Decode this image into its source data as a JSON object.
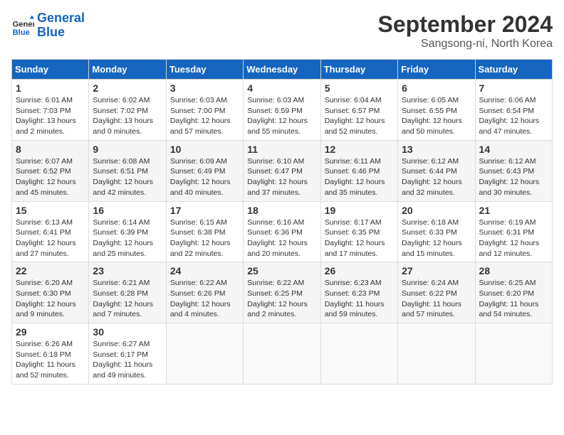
{
  "header": {
    "logo_line1": "General",
    "logo_line2": "Blue",
    "month": "September 2024",
    "location": "Sangsong-ni, North Korea"
  },
  "days_of_week": [
    "Sunday",
    "Monday",
    "Tuesday",
    "Wednesday",
    "Thursday",
    "Friday",
    "Saturday"
  ],
  "weeks": [
    [
      {
        "day": "1",
        "sunrise": "6:01 AM",
        "sunset": "7:03 PM",
        "daylight": "13 hours and 2 minutes."
      },
      {
        "day": "2",
        "sunrise": "6:02 AM",
        "sunset": "7:02 PM",
        "daylight": "13 hours and 0 minutes."
      },
      {
        "day": "3",
        "sunrise": "6:03 AM",
        "sunset": "7:00 PM",
        "daylight": "12 hours and 57 minutes."
      },
      {
        "day": "4",
        "sunrise": "6:03 AM",
        "sunset": "6:59 PM",
        "daylight": "12 hours and 55 minutes."
      },
      {
        "day": "5",
        "sunrise": "6:04 AM",
        "sunset": "6:57 PM",
        "daylight": "12 hours and 52 minutes."
      },
      {
        "day": "6",
        "sunrise": "6:05 AM",
        "sunset": "6:55 PM",
        "daylight": "12 hours and 50 minutes."
      },
      {
        "day": "7",
        "sunrise": "6:06 AM",
        "sunset": "6:54 PM",
        "daylight": "12 hours and 47 minutes."
      }
    ],
    [
      {
        "day": "8",
        "sunrise": "6:07 AM",
        "sunset": "6:52 PM",
        "daylight": "12 hours and 45 minutes."
      },
      {
        "day": "9",
        "sunrise": "6:08 AM",
        "sunset": "6:51 PM",
        "daylight": "12 hours and 42 minutes."
      },
      {
        "day": "10",
        "sunrise": "6:09 AM",
        "sunset": "6:49 PM",
        "daylight": "12 hours and 40 minutes."
      },
      {
        "day": "11",
        "sunrise": "6:10 AM",
        "sunset": "6:47 PM",
        "daylight": "12 hours and 37 minutes."
      },
      {
        "day": "12",
        "sunrise": "6:11 AM",
        "sunset": "6:46 PM",
        "daylight": "12 hours and 35 minutes."
      },
      {
        "day": "13",
        "sunrise": "6:12 AM",
        "sunset": "6:44 PM",
        "daylight": "12 hours and 32 minutes."
      },
      {
        "day": "14",
        "sunrise": "6:12 AM",
        "sunset": "6:43 PM",
        "daylight": "12 hours and 30 minutes."
      }
    ],
    [
      {
        "day": "15",
        "sunrise": "6:13 AM",
        "sunset": "6:41 PM",
        "daylight": "12 hours and 27 minutes."
      },
      {
        "day": "16",
        "sunrise": "6:14 AM",
        "sunset": "6:39 PM",
        "daylight": "12 hours and 25 minutes."
      },
      {
        "day": "17",
        "sunrise": "6:15 AM",
        "sunset": "6:38 PM",
        "daylight": "12 hours and 22 minutes."
      },
      {
        "day": "18",
        "sunrise": "6:16 AM",
        "sunset": "6:36 PM",
        "daylight": "12 hours and 20 minutes."
      },
      {
        "day": "19",
        "sunrise": "6:17 AM",
        "sunset": "6:35 PM",
        "daylight": "12 hours and 17 minutes."
      },
      {
        "day": "20",
        "sunrise": "6:18 AM",
        "sunset": "6:33 PM",
        "daylight": "12 hours and 15 minutes."
      },
      {
        "day": "21",
        "sunrise": "6:19 AM",
        "sunset": "6:31 PM",
        "daylight": "12 hours and 12 minutes."
      }
    ],
    [
      {
        "day": "22",
        "sunrise": "6:20 AM",
        "sunset": "6:30 PM",
        "daylight": "12 hours and 9 minutes."
      },
      {
        "day": "23",
        "sunrise": "6:21 AM",
        "sunset": "6:28 PM",
        "daylight": "12 hours and 7 minutes."
      },
      {
        "day": "24",
        "sunrise": "6:22 AM",
        "sunset": "6:26 PM",
        "daylight": "12 hours and 4 minutes."
      },
      {
        "day": "25",
        "sunrise": "6:22 AM",
        "sunset": "6:25 PM",
        "daylight": "12 hours and 2 minutes."
      },
      {
        "day": "26",
        "sunrise": "6:23 AM",
        "sunset": "6:23 PM",
        "daylight": "11 hours and 59 minutes."
      },
      {
        "day": "27",
        "sunrise": "6:24 AM",
        "sunset": "6:22 PM",
        "daylight": "11 hours and 57 minutes."
      },
      {
        "day": "28",
        "sunrise": "6:25 AM",
        "sunset": "6:20 PM",
        "daylight": "11 hours and 54 minutes."
      }
    ],
    [
      {
        "day": "29",
        "sunrise": "6:26 AM",
        "sunset": "6:18 PM",
        "daylight": "11 hours and 52 minutes."
      },
      {
        "day": "30",
        "sunrise": "6:27 AM",
        "sunset": "6:17 PM",
        "daylight": "11 hours and 49 minutes."
      },
      null,
      null,
      null,
      null,
      null
    ]
  ]
}
